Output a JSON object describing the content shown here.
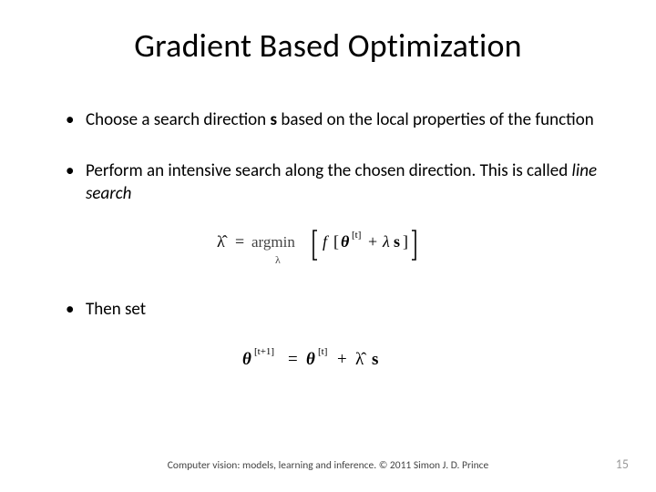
{
  "title": "Gradient Based Optimization",
  "bullets": {
    "b1_pre": "Choose a search direction ",
    "b1_var": "s",
    "b1_post": " based on the local properties of the function",
    "b2_pre": "Perform an intensive search along the chosen direction. This is called ",
    "b2_em": "line search",
    "b3": "Then set"
  },
  "formula1_alt": "lambda-hat = argmin over lambda of [ f[ theta^[t] + lambda s ] ]",
  "formula2_alt": "theta^[t+1] = theta^[t] + lambda-hat s",
  "footer": "Computer vision: models, learning and inference.  © 2011 Simon J. D. Prince",
  "page_number": "15"
}
